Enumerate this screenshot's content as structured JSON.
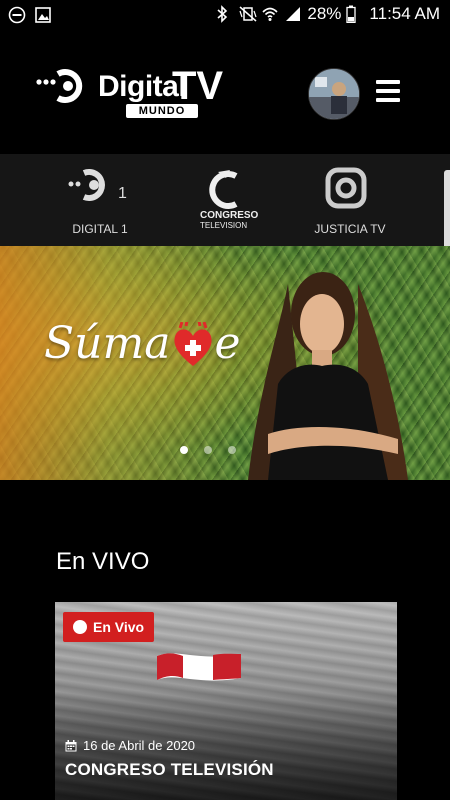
{
  "status_bar": {
    "battery_percent": "28%",
    "time": "11:54 AM"
  },
  "header": {
    "logo_word": "Digital",
    "logo_tv": "TV",
    "logo_sub": "MUNDO"
  },
  "channels": [
    {
      "label": "DIGITAL 1",
      "icon": "digital1-logo-icon"
    },
    {
      "label": "CONGRESO TELEVISION",
      "icon": "congreso-logo-icon"
    },
    {
      "label": "JUSTICIA TV",
      "icon": "justicia-logo-icon"
    }
  ],
  "channel_logo_text": {
    "digital1_number": "1",
    "congreso_top": "CONGRESO",
    "congreso_bottom": "TELEVISION"
  },
  "banner": {
    "headline_prefix": "Súma",
    "headline_suffix": "e",
    "slide_count": 3,
    "active_slide": 1
  },
  "live_section": {
    "title": "En VIVO",
    "card": {
      "badge": "En Vivo",
      "date": "16 de Abril de 2020",
      "title": "CONGRESO TELEVISIÓN"
    }
  },
  "colors": {
    "accent_red": "#d21f1f",
    "background": "#000000",
    "channel_bar": "#161616"
  }
}
